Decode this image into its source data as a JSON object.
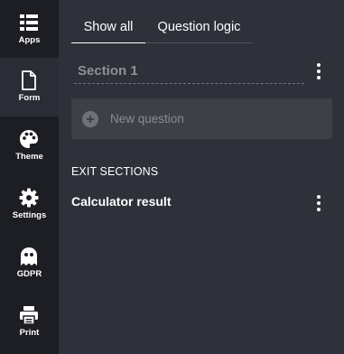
{
  "sidebar": {
    "items": [
      {
        "label": "Apps",
        "icon": "grid-list-icon"
      },
      {
        "label": "Form",
        "icon": "document-icon"
      },
      {
        "label": "Theme",
        "icon": "palette-icon"
      },
      {
        "label": "Settings",
        "icon": "gear-icon"
      },
      {
        "label": "GDPR",
        "icon": "ghost-icon"
      },
      {
        "label": "Print",
        "icon": "printer-icon"
      }
    ],
    "active": "Form"
  },
  "tabs": [
    {
      "label": "Show all",
      "active": true
    },
    {
      "label": "Question logic",
      "active": false
    }
  ],
  "section": {
    "title": "Section 1",
    "new_question_label": "New question"
  },
  "exit_sections": {
    "heading": "EXIT SECTIONS",
    "items": [
      {
        "label": "Calculator result"
      }
    ]
  },
  "colors": {
    "sidebar_bg": "#1c1e23",
    "content_bg": "#2e313a",
    "active_nav_bg": "#2a2d35",
    "new_question_bg": "#3d4047"
  }
}
